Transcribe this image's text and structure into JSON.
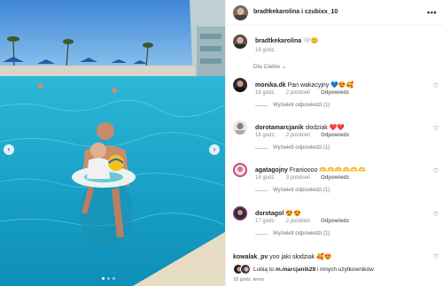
{
  "post": {
    "header": {
      "username": "bradtkekarolina i czubixx_10",
      "more_icon": "more-dots-icon",
      "more_label": "•••"
    },
    "caption": {
      "username": "bradtkekarolina",
      "text": "🤍😊",
      "time": "18 godz."
    },
    "language_filter": "Dla Ciebie ⌄",
    "comments": [
      {
        "username": "monika.dk",
        "text": "Pan wakacyjny 💙😍🥰",
        "time": "18 godz.",
        "likes": "2 polubień",
        "reply": "Odpowiedz",
        "view_replies": "Wyświetl odpowiedzi (1)"
      },
      {
        "username": "dorotamarcjanik",
        "text": "słodziak ❤️❤️",
        "time": "18 godz.",
        "likes": "2 polubień",
        "reply": "Odpowiedz",
        "view_replies": "Wyświetl odpowiedzi (1)"
      },
      {
        "username": "agatagojny",
        "text": "Franioooo 🫶🫶🫶🫶🫶🫶",
        "time": "18 godz.",
        "likes": "3 polubień",
        "reply": "Odpowiedz",
        "view_replies": "Wyświetl odpowiedzi (1)"
      },
      {
        "username": "dorotagol",
        "text": "😍😍",
        "time": "17 godz.",
        "likes": "2 polubień",
        "reply": "Odpowiedz",
        "view_replies": "Wyświetl odpowiedzi (1)"
      },
      {
        "username": "kowalak_pv",
        "text": "yoo jaki słodziak 🥰😍"
      }
    ],
    "footer": {
      "likes_prefix": "Lubią to ",
      "likes_user": "m.marcjanik29",
      "likes_suffix": " i innych użytkowników",
      "posted": "18 godz. temu"
    },
    "media": {
      "prev_label": "‹",
      "next_label": "›"
    }
  }
}
